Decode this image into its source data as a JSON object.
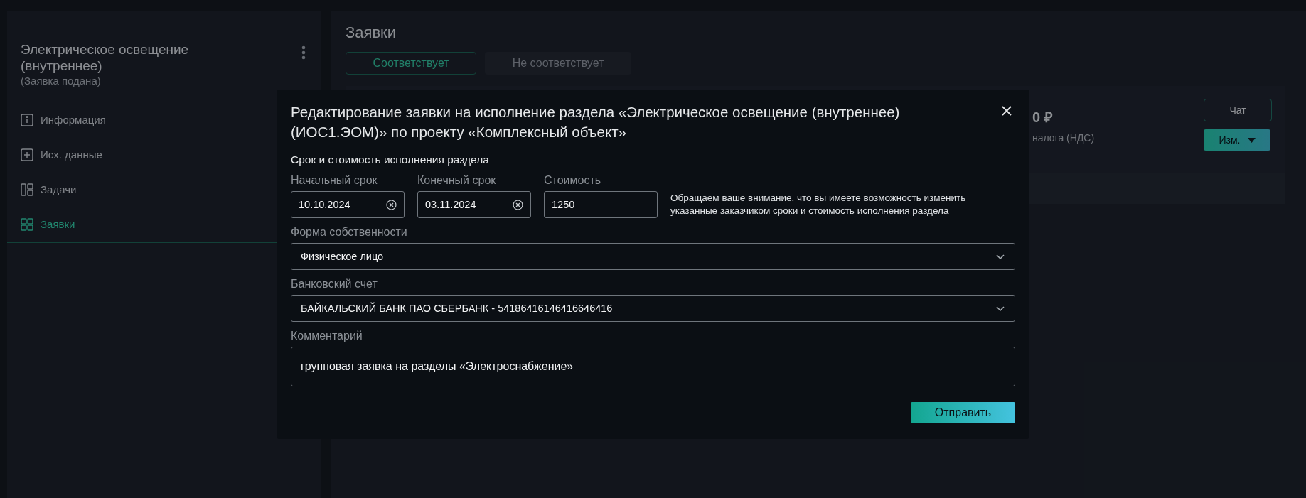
{
  "sidebar": {
    "title": "Электрическое освещение (внутреннее)",
    "status": "(Заявка подана)",
    "items": [
      {
        "label": "Информация",
        "selected": false
      },
      {
        "label": "Исх. данные",
        "selected": false
      },
      {
        "label": "Задачи",
        "selected": false
      },
      {
        "label": "Заявки",
        "selected": true
      }
    ]
  },
  "main": {
    "title": "Заявки",
    "tabs": [
      {
        "label": "Соответствует",
        "selected": true
      },
      {
        "label": "Не соответствует",
        "selected": false
      }
    ],
    "card": {
      "amount": "0 ₽",
      "tax_note": "налога (НДС)",
      "chat_button": "Чат",
      "change_button": "Изм."
    }
  },
  "modal": {
    "title": "Редактирование заявки на исполнение раздела «Электрическое освещение (внутреннее) (ИОС1.ЭОМ)» по проекту «Комплексный объект»",
    "section_title": "Срок и стоимость исполнения раздела",
    "start_date": {
      "label": "Начальный срок",
      "value": "10.10.2024"
    },
    "end_date": {
      "label": "Конечный срок",
      "value": "03.11.2024"
    },
    "cost": {
      "label": "Стоимость",
      "value": "1250"
    },
    "note": "Обращаем ваше внимание, что вы имеете возможность изменить указанные заказчиком сроки и стоимость исполнения раздела",
    "ownership": {
      "label": "Форма собственности",
      "value": "Физическое лицо"
    },
    "bank_account": {
      "label": "Банковский счет",
      "value": "БАЙКАЛЬСКИЙ БАНК ПАО СБЕРБАНК - 54186416146416646416"
    },
    "comment": {
      "label": "Комментарий",
      "value": "групповая заявка на разделы «Электроснабжение»"
    },
    "submit": "Отправить"
  }
}
